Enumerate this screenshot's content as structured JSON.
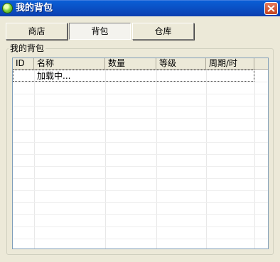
{
  "window": {
    "title": "我的背包"
  },
  "tabs": [
    {
      "label": "商店"
    },
    {
      "label": "背包"
    },
    {
      "label": "仓库"
    }
  ],
  "active_tab": "背包",
  "group": {
    "label": "我的背包"
  },
  "table": {
    "columns": [
      "ID",
      "名称",
      "数量",
      "等级",
      "周期/时"
    ],
    "rows": [
      {
        "id": "",
        "name": "加载中...",
        "quantity": "",
        "level": "",
        "period": ""
      }
    ]
  },
  "colors": {
    "titlebar": "#0b4fc4",
    "dialog_bg": "#ece9d8",
    "close_button": "#d9572f"
  }
}
